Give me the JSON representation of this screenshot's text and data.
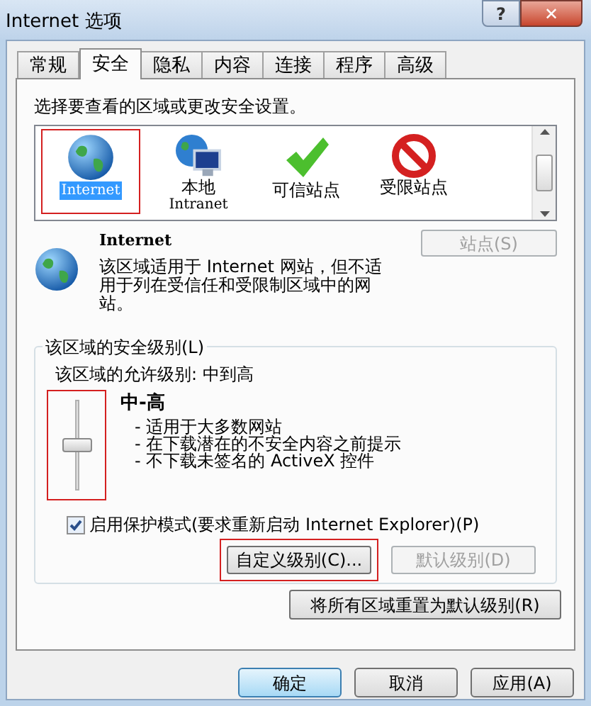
{
  "window": {
    "title": "Internet 选项"
  },
  "title_buttons": [
    {
      "kind": "help",
      "label": "?"
    },
    {
      "kind": "close",
      "label": "✕"
    }
  ],
  "tabs": [
    {
      "label": "常规",
      "selected": false
    },
    {
      "label": "安全",
      "selected": true
    },
    {
      "label": "隐私",
      "selected": false
    },
    {
      "label": "内容",
      "selected": false
    },
    {
      "label": "连接",
      "selected": false
    },
    {
      "label": "程序",
      "selected": false
    },
    {
      "label": "高级",
      "selected": false
    }
  ],
  "zone_prompt": "选择要查看的区域或更改安全设置。",
  "zones": [
    {
      "kind": "internet",
      "label": "Internet",
      "selected": true,
      "highlighted": true
    },
    {
      "kind": "intranet",
      "label": "本地",
      "sublabel": "Intranet",
      "selected": false,
      "highlighted": false
    },
    {
      "kind": "trusted",
      "label": "可信站点",
      "selected": false,
      "highlighted": false
    },
    {
      "kind": "restricted",
      "label": "受限站点",
      "selected": false,
      "highlighted": false
    }
  ],
  "zone_detail": {
    "title": "Internet",
    "description": "该区域适用于 Internet 网站，但不适用于列在受信任和受限制区域中的网站。",
    "sites_button": {
      "label": "站点(S)",
      "disabled": true
    }
  },
  "security_level": {
    "legend": "该区域的安全级别(L)",
    "allowed": "该区域的允许级别: 中到高",
    "slider": {
      "level": 0.5,
      "highlighted": true
    },
    "level_name": "中-高",
    "bullets": [
      "- 适用于大多数网站",
      "- 在下载潜在的不安全内容之前提示",
      "- 不下载未签名的 ActiveX 控件"
    ],
    "protected_mode": {
      "label": "启用保护模式(要求重新启动 Internet Explorer)(P)",
      "checked": true
    },
    "buttons": [
      {
        "label": "自定义级别(C)...",
        "disabled": false,
        "highlighted": true
      },
      {
        "label": "默认级别(D)",
        "disabled": true,
        "highlighted": false
      }
    ]
  },
  "reset_button": {
    "label": "将所有区域重置为默认级别(R)"
  },
  "dialog_buttons": [
    {
      "label": "确定",
      "default": true
    },
    {
      "label": "取消",
      "default": false
    },
    {
      "label": "应用(A)",
      "default": false
    }
  ]
}
